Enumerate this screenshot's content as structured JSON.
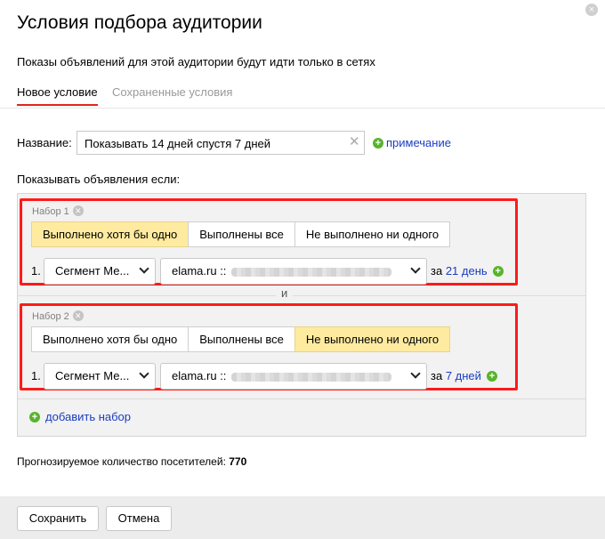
{
  "dialog": {
    "title": "Условия подбора аудитории",
    "subtitle": "Показы объявлений для этой аудитории будут идти только в сетях",
    "close_icon": "×"
  },
  "tabs": [
    {
      "label": "Новое условие",
      "active": true
    },
    {
      "label": "Сохраненные условия",
      "active": false
    }
  ],
  "name": {
    "label": "Название:",
    "value": "Показывать 14 дней спустя 7 дней",
    "clear_icon": "✕",
    "note_link": "примечание"
  },
  "show_if_label": "Показывать объявления если:",
  "sets": [
    {
      "header": "Набор 1",
      "options": [
        "Выполнено хотя бы одно",
        "Выполнены все",
        "Не выполнено ни одного"
      ],
      "selected_option": "Выполнено хотя бы одно",
      "rule_number": "1.",
      "rule_type": "Сегмент Ме...",
      "rule_value": "elama.ru ::",
      "period_prefix": "за",
      "period_link": "21 день"
    },
    {
      "header": "Набор 2",
      "options": [
        "Выполнено хотя бы одно",
        "Выполнены все",
        "Не выполнено ни одного"
      ],
      "selected_option": "Не выполнено ни одного",
      "rule_number": "1.",
      "rule_type": "Сегмент Ме...",
      "rule_value": "elama.ru ::",
      "period_prefix": "за",
      "period_link": "7 дней"
    }
  ],
  "and_label": "и",
  "add_set_label": "добавить набор",
  "forecast": {
    "label": "Прогнозируемое количество посетителей:",
    "value": "770"
  },
  "footer": {
    "save": "Сохранить",
    "cancel": "Отмена"
  },
  "colors": {
    "accent_link": "#1a3dc1",
    "selected_segment": "#ffeba0",
    "highlight_frame": "#ff1a1a",
    "tab_underline": "#e1251b",
    "plus_icon": "#58b42a"
  }
}
